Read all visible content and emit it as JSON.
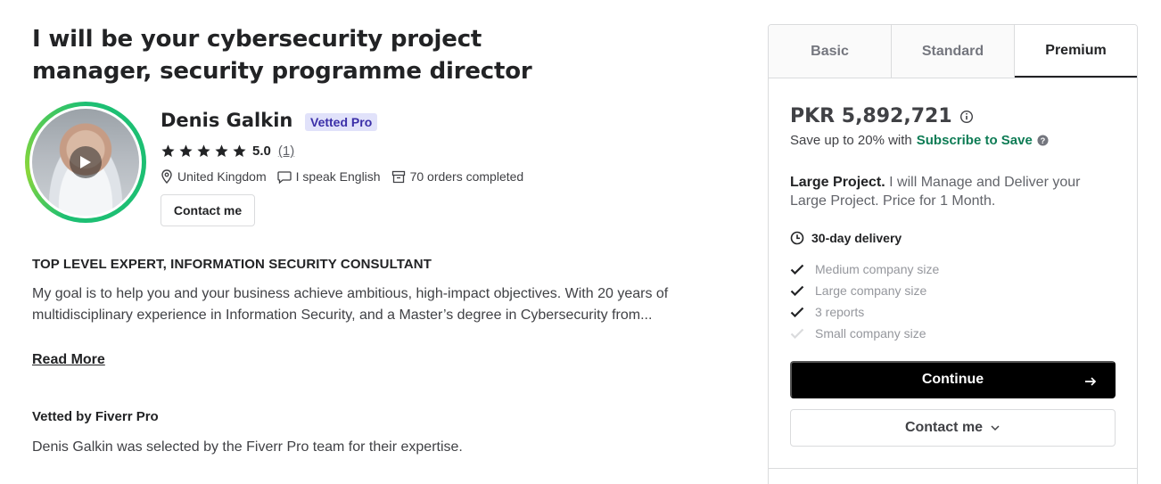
{
  "gig": {
    "title": "I will be your cybersecurity project manager, security programme director"
  },
  "seller": {
    "name": "Denis Galkin",
    "badge": "Vetted Pro",
    "rating": "5.0",
    "rating_count": "(1)",
    "location": "United Kingdom",
    "language": "I speak English",
    "orders": "70 orders completed",
    "contact_label": "Contact me"
  },
  "about": {
    "headline": "TOP LEVEL EXPERT, INFORMATION SECURITY CONSULTANT",
    "description": "My goal is to help you and your business achieve ambitious, high-impact objectives. With 20 years of multidisciplinary experience in Information Security, and a Master’s degree in Cybersecurity from...",
    "read_more": "Read More"
  },
  "vetted": {
    "heading": "Vetted by Fiverr Pro",
    "text": "Denis Galkin was selected by the Fiverr Pro team for their expertise."
  },
  "package": {
    "tabs": [
      {
        "label": "Basic"
      },
      {
        "label": "Standard"
      },
      {
        "label": "Premium"
      }
    ],
    "active_tab": "Premium",
    "price": "PKR 5,892,721",
    "save_prefix": "Save up to 20% with",
    "save_link": "Subscribe to Save",
    "desc_title": "Large Project.",
    "desc_body": "I will Manage and Deliver your Large Project. Price for 1 Month.",
    "delivery": "30-day delivery",
    "features": [
      {
        "label": "Medium company size",
        "included": true
      },
      {
        "label": "Large company size",
        "included": true
      },
      {
        "label": "3 reports",
        "included": true
      },
      {
        "label": "Small company size",
        "included": false
      }
    ],
    "continue_label": "Continue",
    "contact_label": "Contact me"
  },
  "colors": {
    "accent_green": "#1dbf73",
    "badge_bg": "#e1e2fa",
    "text_dark": "#222325"
  }
}
